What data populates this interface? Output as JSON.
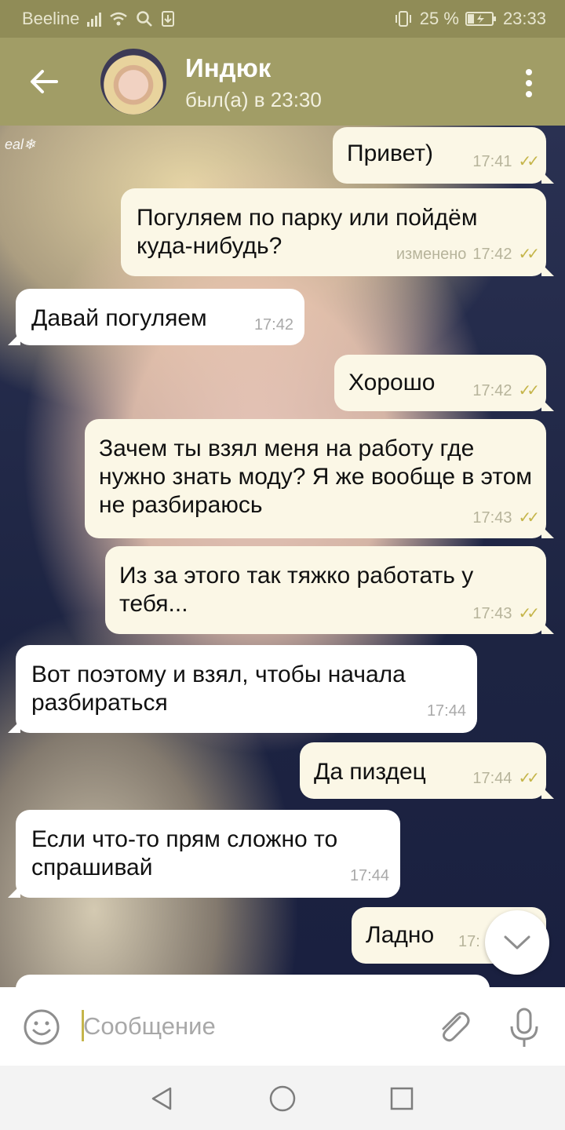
{
  "status_bar": {
    "carrier": "Beeline",
    "battery": "25 %",
    "time": "23:33"
  },
  "header": {
    "title": "Индюк",
    "status": "был(а) в 23:30"
  },
  "wallpaper": {
    "watermark": "eal❄"
  },
  "messages": [
    {
      "direction": "out",
      "text": "Привет)",
      "time": "17:41"
    },
    {
      "direction": "out",
      "text": "Погуляем по парку или пойдём куда-нибудь?",
      "edited": "изменено",
      "time": "17:42"
    },
    {
      "direction": "in",
      "text": "Давай погуляем",
      "time": "17:42"
    },
    {
      "direction": "out",
      "text": "Хорошо",
      "time": "17:42"
    },
    {
      "direction": "out",
      "text": "Зачем ты взял меня на работу где нужно знать моду? Я же вообще в этом не разбираюсь",
      "time": "17:43"
    },
    {
      "direction": "out",
      "text": "Из за этого так тяжко работать у тебя...",
      "time": "17:43"
    },
    {
      "direction": "in",
      "text": "Вот поэтому и взял, чтобы начала разбираться",
      "time": "17:44"
    },
    {
      "direction": "out",
      "text": "Да пиздец",
      "time": "17:44"
    },
    {
      "direction": "in",
      "text": "Если что-то прям сложно то спрашивай",
      "time": "17:44"
    },
    {
      "direction": "out",
      "text": "Ладно",
      "time": "17:"
    }
  ],
  "input": {
    "placeholder": "Сообщение"
  },
  "icons": [
    "back-arrow-icon",
    "more-vert-icon",
    "emoji-icon",
    "paperclip-icon",
    "mic-icon",
    "chevron-down-icon",
    "nav-back-icon",
    "nav-home-icon",
    "nav-recents-icon"
  ],
  "colors": {
    "header": "#a19d66",
    "status_bar": "#908c57",
    "bubble_out": "#fbf7e6",
    "bubble_in": "#ffffff",
    "read_check": "#c5b54a"
  }
}
